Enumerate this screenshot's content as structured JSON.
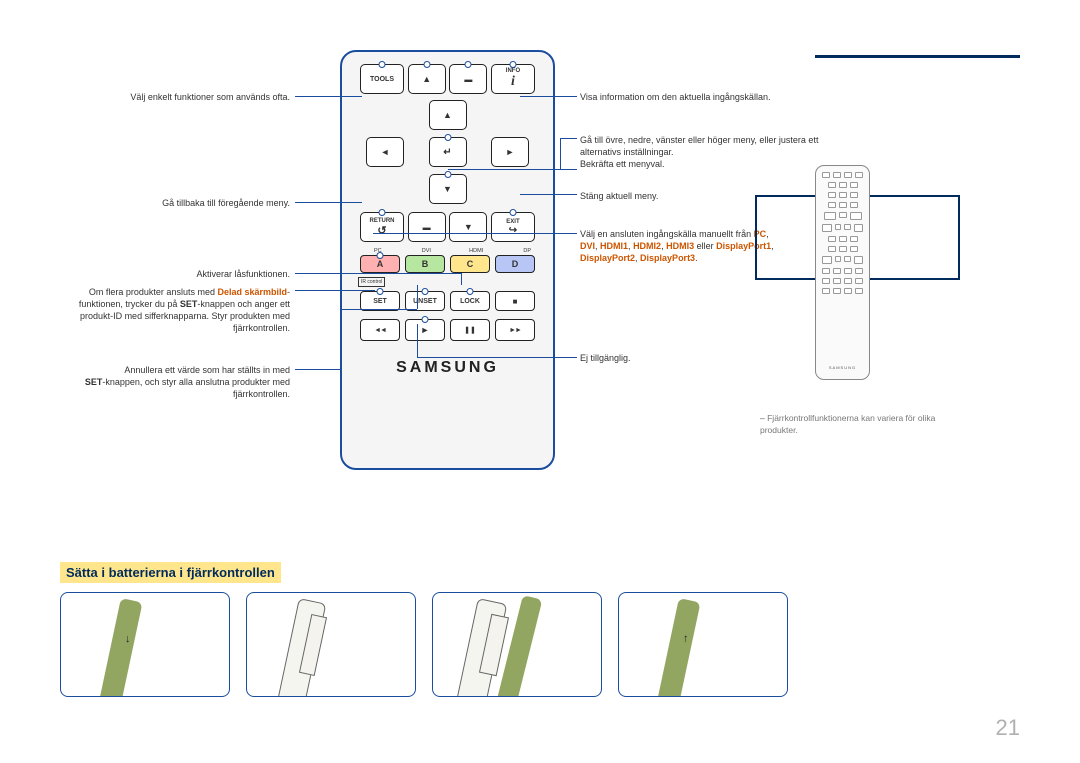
{
  "header_border": true,
  "remote": {
    "tools_label": "TOOLS",
    "info_label": "INFO",
    "return_label": "RETURN",
    "exit_label": "EXIT",
    "tiny_labels": {
      "a": "PC",
      "b": "DVI",
      "c": "HDMI",
      "d": "DP"
    },
    "abcd": {
      "a": "A",
      "b": "B",
      "c": "C",
      "d": "D"
    },
    "ir_label": "IR control",
    "set_label": "SET",
    "unset_label": "UNSET",
    "lock_label": "LOCK",
    "brand": "SAMSUNG"
  },
  "labels_left": {
    "tools": "Välj enkelt funktioner som används ofta.",
    "return": "Gå tillbaka till föregående meny.",
    "lock": "Aktiverar låsfunktionen.",
    "set_line1": "Om flera produkter ansluts med ",
    "set_highlight": "Delad skärmbild",
    "set_line2": "funktionen, trycker du på ",
    "set_bold": "SET",
    "set_line3": "-knappen och anger ett produkt-ID med sifferknapparna. Styr produkten med fjärrkontrollen.",
    "unset_line1": "Annullera ett värde som har ställts in med ",
    "unset_bold": "SET",
    "unset_line2": "-knappen, och styr alla anslutna produkter med fjärrkontrollen."
  },
  "labels_right": {
    "info": "Visa information om den aktuella ingångskällan.",
    "dpad_line1": "Gå till övre, nedre, vänster eller höger meny, eller justera ett alternativs inställningar.",
    "dpad_line2": "Bekräfta ett menyval.",
    "exit": "Stäng aktuell meny.",
    "abcd_line1": "Välj en ansluten ingångskälla manuellt från ",
    "abcd_pc": "PC",
    "abcd_sep1": ", ",
    "abcd_dvi": "DVI",
    "abcd_hdmi1": "HDMI1",
    "abcd_hdmi2": "HDMI2",
    "abcd_hdmi3": "HDMI3",
    "abcd_or": " eller ",
    "abcd_dp1": "DisplayPort1",
    "abcd_dp2": "DisplayPort2",
    "abcd_dp3": "DisplayPort3",
    "abcd_period": ".",
    "playback": "Ej tillgänglig."
  },
  "side_diagram": {
    "brand": "SAMSUNG"
  },
  "footnote_dash": "–",
  "footnote": "Fjärrkontrollfunktionerna kan variera för olika produkter.",
  "section_title": "Sätta i batterierna i fjärrkontrollen",
  "page_number": "21"
}
